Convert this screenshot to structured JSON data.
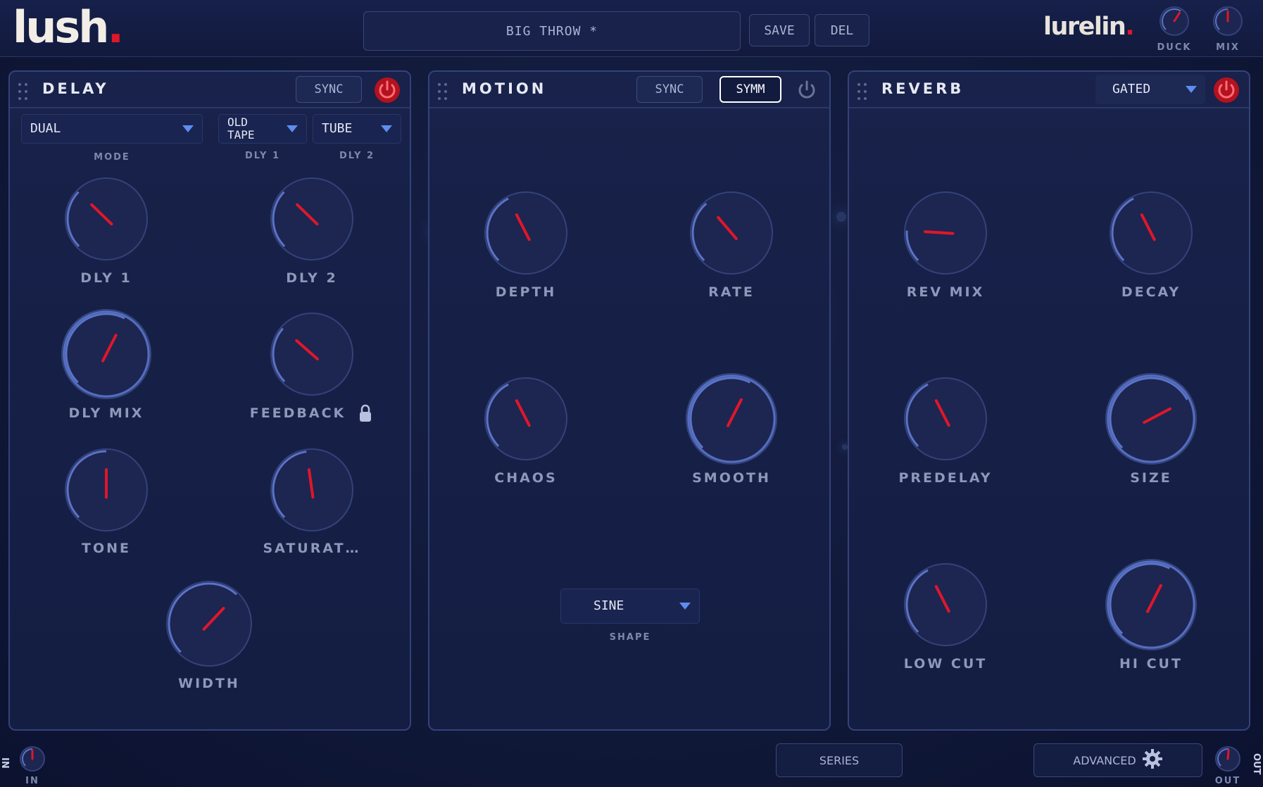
{
  "brand": {
    "left_logo": "lush",
    "right_logo": "lurelin",
    "dot": "."
  },
  "topbar": {
    "preset_name": "BIG THROW *",
    "save_label": "SAVE",
    "delete_label": "DEL",
    "duck_label": "DUCK",
    "mix_label": "MIX"
  },
  "colors": {
    "accent_red": "#e0162a",
    "accent_blue": "#5d8df0",
    "panel_border": "#34427a"
  },
  "delay": {
    "title": "DELAY",
    "sync_label": "SYNC",
    "mode": {
      "value": "DUAL",
      "label": "MODE"
    },
    "dly1_type": {
      "value_line1": "OLD",
      "value_line2": "TAPE",
      "label": "DLY 1"
    },
    "dly2_type": {
      "value": "TUBE",
      "label": "DLY 2"
    },
    "knobs": {
      "dly1": "DLY 1",
      "dly2": "DLY 2",
      "dly_mix": "DLY MIX",
      "feedback": "FEEDBACK",
      "tone": "TONE",
      "saturation": "SATURAT…",
      "width": "WIDTH"
    }
  },
  "motion": {
    "title": "MOTION",
    "sync_label": "SYNC",
    "symm_label": "SYMM",
    "knobs": {
      "depth": "DEPTH",
      "rate": "RATE",
      "chaos": "CHAOS",
      "smooth": "SMOOTH"
    },
    "shape": {
      "value": "SINE",
      "label": "SHAPE"
    }
  },
  "reverb": {
    "title": "REVERB",
    "type": {
      "value": "GATED"
    },
    "knobs": {
      "rev_mix": "REV MIX",
      "decay": "DECAY",
      "predelay": "PREDELAY",
      "size": "SIZE",
      "low_cut": "LOW CUT",
      "hi_cut": "HI CUT"
    }
  },
  "footer": {
    "series_label": "SERIES",
    "advanced_label": "ADVANCED",
    "in_label": "IN",
    "out_label": "OUT",
    "in_side": "IN",
    "out_side": "OUT"
  },
  "knob_values": {
    "duck": 0.62,
    "mix": 0.5,
    "dly1": 0.33,
    "dly2": 0.33,
    "dly_mix": 0.6,
    "feedback": 0.32,
    "tone": 0.5,
    "saturation": 0.47,
    "width": 0.66,
    "depth": 0.4,
    "rate": 0.35,
    "chaos": 0.4,
    "smooth": 0.6,
    "rev_mix": 0.18,
    "decay": 0.4,
    "predelay": 0.4,
    "size": 0.73,
    "low_cut": 0.4,
    "hi_cut": 0.6,
    "in": 0.5,
    "out": 0.52
  }
}
